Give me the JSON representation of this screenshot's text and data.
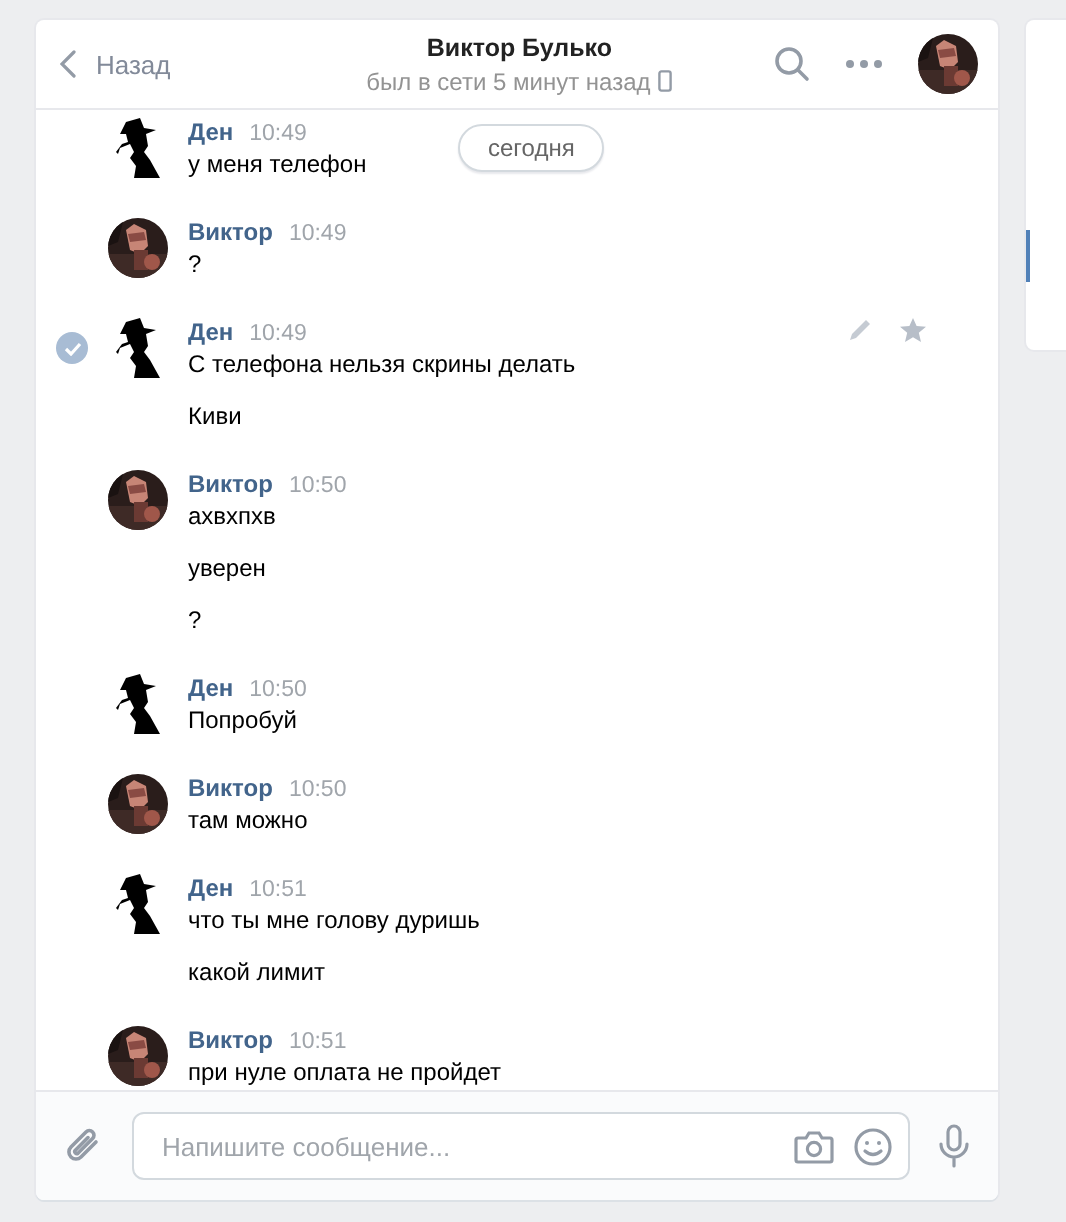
{
  "header": {
    "back": "Назад",
    "title": "Виктор Булько",
    "status": "был в сети 5 минут назад"
  },
  "date_badge": "сегодня",
  "messages": [
    {
      "author": "Ден",
      "time": "10:49",
      "kind": "silhouette",
      "selected": false,
      "lines": [
        "у меня телефон"
      ]
    },
    {
      "author": "Виктор",
      "time": "10:49",
      "selected": false,
      "lines": [
        "?"
      ]
    },
    {
      "author": "Ден",
      "time": "10:49",
      "kind": "silhouette",
      "selected": true,
      "lines": [
        "С телефона нельзя скрины делать",
        "Киви"
      ]
    },
    {
      "author": "Виктор",
      "time": "10:50",
      "selected": false,
      "lines": [
        "ахвхпхв",
        "уверен",
        "?"
      ]
    },
    {
      "author": "Ден",
      "time": "10:50",
      "kind": "silhouette",
      "selected": false,
      "lines": [
        "Попробуй"
      ]
    },
    {
      "author": "Виктор",
      "time": "10:50",
      "selected": false,
      "lines": [
        "там можно"
      ]
    },
    {
      "author": "Ден",
      "time": "10:51",
      "kind": "silhouette",
      "selected": false,
      "lines": [
        "что ты мне голову дуришь",
        "какой лимит"
      ]
    },
    {
      "author": "Виктор",
      "time": "10:51",
      "selected": false,
      "lines": [
        "при нуле оплата не пройдет"
      ]
    }
  ],
  "composer": {
    "placeholder": "Напишите сообщение..."
  }
}
